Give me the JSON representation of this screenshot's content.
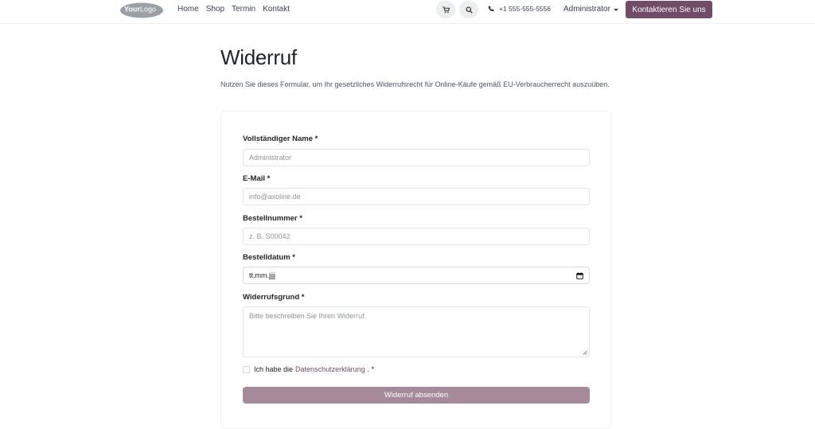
{
  "header": {
    "logo_text_1": "Your",
    "logo_text_2": "Logo",
    "nav": [
      "Home",
      "Shop",
      "Termin",
      "Kontakt"
    ],
    "phone": "+1 555-555-5556",
    "user": "Administrator",
    "cta_label": "Kontaktieren Sie uns",
    "icons": {
      "cart": "cart-icon",
      "search": "search-icon",
      "phone": "phone-icon"
    }
  },
  "page": {
    "title": "Widerruf",
    "intro": "Nutzen Sie dieses Formular, um Ihr gesetzliches Widerrufsrecht für Online-Käufe gemäß EU-Verbraucherrecht auszuüben."
  },
  "form": {
    "name_label": "Vollständiger Name *",
    "name_placeholder": "Administrator",
    "email_label": "E-Mail *",
    "email_placeholder": "info@axoline.de",
    "order_label": "Bestellnummer *",
    "order_placeholder": "z. B. S00042",
    "date_label": "Bestelldatum *",
    "date_value": "tt.mm.jjjj",
    "reason_label": "Widerrufsgrund *",
    "reason_placeholder": "Bitte beschreiben Sie Ihren Widerruf.",
    "consent_prefix": "Ich habe die",
    "consent_link": "Datenschutzerklärung",
    "consent_suffix": ". *",
    "submit_label": "Widerruf absenden"
  },
  "colors": {
    "brand": "#714b67",
    "submit_disabled": "#a48a9b"
  }
}
